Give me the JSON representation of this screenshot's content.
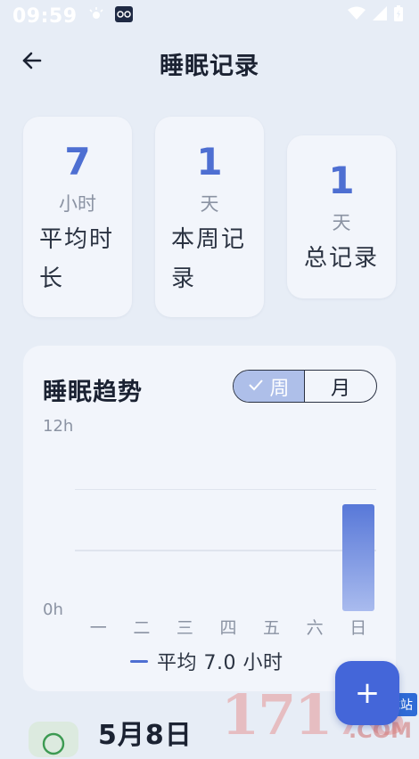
{
  "status_bar": {
    "time": "09:59",
    "icons": [
      "brightness-icon",
      "app-glasses-icon",
      "wifi-icon",
      "signal-icon",
      "battery-icon"
    ]
  },
  "header": {
    "title": "睡眠记录",
    "back_icon": "arrow-left-icon"
  },
  "stats": [
    {
      "value": "7",
      "unit": "小时",
      "label": "平均时长"
    },
    {
      "value": "1",
      "unit": "天",
      "label": "本周记录"
    },
    {
      "value": "1",
      "unit": "天",
      "label": "总记录"
    }
  ],
  "trend": {
    "title": "睡眠趋势",
    "toggle": {
      "week": "周",
      "month": "月",
      "selected": "周"
    },
    "legend": "平均 7.0 小时"
  },
  "chart_data": {
    "type": "bar",
    "categories": [
      "一",
      "二",
      "三",
      "四",
      "五",
      "六",
      "日"
    ],
    "values": [
      0,
      0,
      0,
      0,
      0,
      0,
      7
    ],
    "ylim": [
      0,
      12
    ],
    "y_tick_labels": [
      "12h",
      "0h"
    ],
    "grid": true,
    "legend_position": "bottom",
    "bar_color": "#5878d8"
  },
  "record": {
    "date": "5月8日"
  },
  "fab": {
    "icon": "plus-icon",
    "label": "+"
  },
  "watermark": {
    "digits": "17178",
    "tag": "下载站",
    "domain": ".COM"
  },
  "colors": {
    "accent": "#4e6fd2",
    "background": "#e7edf6",
    "card": "#f2f5fb",
    "fab": "#4466d9"
  }
}
